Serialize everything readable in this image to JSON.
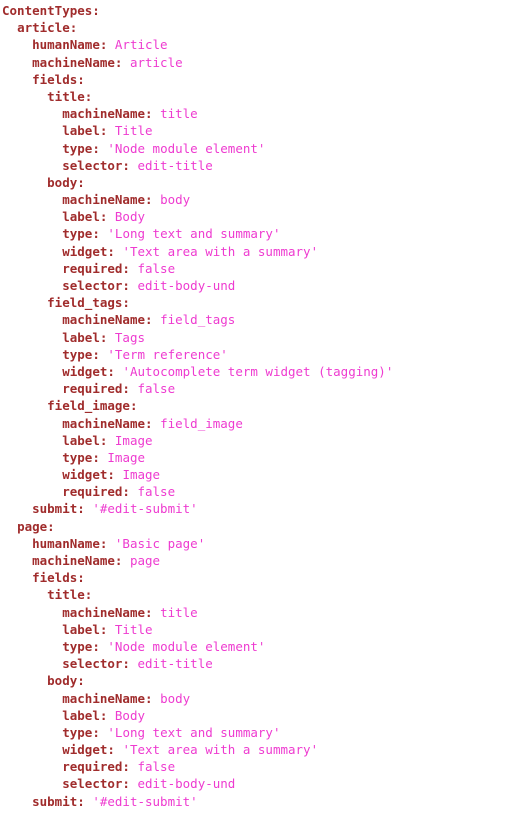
{
  "document": {
    "format": "yaml",
    "root_key": "ContentTypes",
    "colors": {
      "background": "#ffffff",
      "key": "#A02C2C",
      "value": "#EE3BD0"
    },
    "indent_unit_spaces": 2,
    "lines": [
      {
        "indent": 0,
        "key": "ContentTypes:",
        "value": ""
      },
      {
        "indent": 1,
        "key": "article:",
        "value": ""
      },
      {
        "indent": 2,
        "key": "humanName:",
        "value": "Article"
      },
      {
        "indent": 2,
        "key": "machineName:",
        "value": "article"
      },
      {
        "indent": 2,
        "key": "fields:",
        "value": ""
      },
      {
        "indent": 3,
        "key": "title:",
        "value": ""
      },
      {
        "indent": 4,
        "key": "machineName:",
        "value": "title"
      },
      {
        "indent": 4,
        "key": "label:",
        "value": "Title"
      },
      {
        "indent": 4,
        "key": "type:",
        "value": "'Node module element'"
      },
      {
        "indent": 4,
        "key": "selector:",
        "value": "edit-title"
      },
      {
        "indent": 3,
        "key": "body:",
        "value": ""
      },
      {
        "indent": 4,
        "key": "machineName:",
        "value": "body"
      },
      {
        "indent": 4,
        "key": "label:",
        "value": "Body"
      },
      {
        "indent": 4,
        "key": "type:",
        "value": "'Long text and summary'"
      },
      {
        "indent": 4,
        "key": "widget:",
        "value": "'Text area with a summary'"
      },
      {
        "indent": 4,
        "key": "required:",
        "value": "false"
      },
      {
        "indent": 4,
        "key": "selector:",
        "value": "edit-body-und"
      },
      {
        "indent": 3,
        "key": "field_tags:",
        "value": ""
      },
      {
        "indent": 4,
        "key": "machineName:",
        "value": "field_tags"
      },
      {
        "indent": 4,
        "key": "label:",
        "value": "Tags"
      },
      {
        "indent": 4,
        "key": "type:",
        "value": "'Term reference'"
      },
      {
        "indent": 4,
        "key": "widget:",
        "value": "'Autocomplete term widget (tagging)'"
      },
      {
        "indent": 4,
        "key": "required:",
        "value": "false"
      },
      {
        "indent": 3,
        "key": "field_image:",
        "value": ""
      },
      {
        "indent": 4,
        "key": "machineName:",
        "value": "field_image"
      },
      {
        "indent": 4,
        "key": "label:",
        "value": "Image"
      },
      {
        "indent": 4,
        "key": "type:",
        "value": "Image"
      },
      {
        "indent": 4,
        "key": "widget:",
        "value": "Image"
      },
      {
        "indent": 4,
        "key": "required:",
        "value": "false"
      },
      {
        "indent": 2,
        "key": "submit:",
        "value": "'#edit-submit'"
      },
      {
        "indent": 1,
        "key": "page:",
        "value": ""
      },
      {
        "indent": 2,
        "key": "humanName:",
        "value": "'Basic page'"
      },
      {
        "indent": 2,
        "key": "machineName:",
        "value": "page"
      },
      {
        "indent": 2,
        "key": "fields:",
        "value": ""
      },
      {
        "indent": 3,
        "key": "title:",
        "value": ""
      },
      {
        "indent": 4,
        "key": "machineName:",
        "value": "title"
      },
      {
        "indent": 4,
        "key": "label:",
        "value": "Title"
      },
      {
        "indent": 4,
        "key": "type:",
        "value": "'Node module element'"
      },
      {
        "indent": 4,
        "key": "selector:",
        "value": "edit-title"
      },
      {
        "indent": 3,
        "key": "body:",
        "value": ""
      },
      {
        "indent": 4,
        "key": "machineName:",
        "value": "body"
      },
      {
        "indent": 4,
        "key": "label:",
        "value": "Body"
      },
      {
        "indent": 4,
        "key": "type:",
        "value": "'Long text and summary'"
      },
      {
        "indent": 4,
        "key": "widget:",
        "value": "'Text area with a summary'"
      },
      {
        "indent": 4,
        "key": "required:",
        "value": "false"
      },
      {
        "indent": 4,
        "key": "selector:",
        "value": "edit-body-und"
      },
      {
        "indent": 2,
        "key": "submit:",
        "value": "'#edit-submit'"
      }
    ]
  }
}
